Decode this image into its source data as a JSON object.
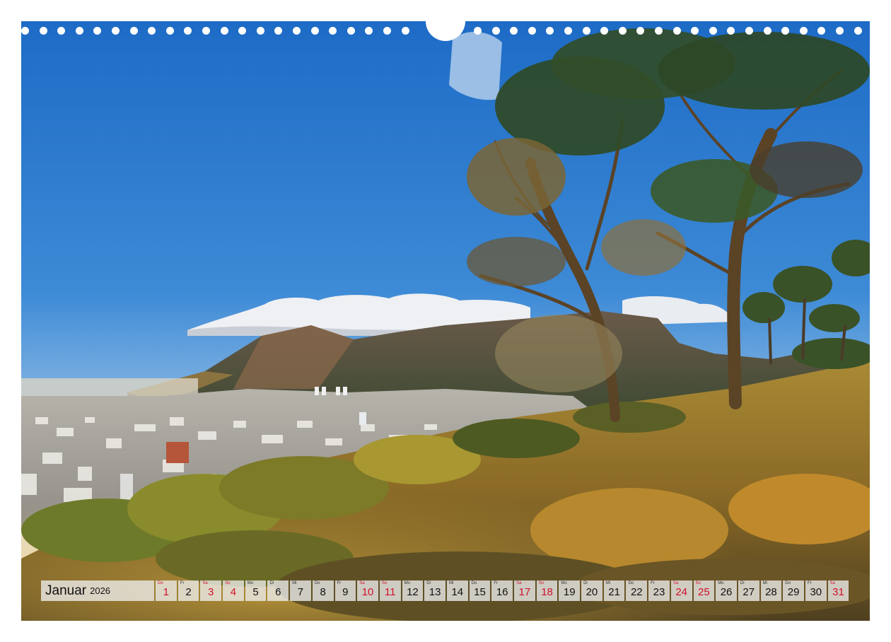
{
  "calendar": {
    "month": "Januar",
    "year": "2026",
    "days": [
      {
        "wd": "Do",
        "num": "1",
        "weekend": true
      },
      {
        "wd": "Fr",
        "num": "2",
        "weekend": false
      },
      {
        "wd": "Sa",
        "num": "3",
        "weekend": true
      },
      {
        "wd": "So",
        "num": "4",
        "weekend": true
      },
      {
        "wd": "Mo",
        "num": "5",
        "weekend": false
      },
      {
        "wd": "Di",
        "num": "6",
        "weekend": false
      },
      {
        "wd": "Mi",
        "num": "7",
        "weekend": false
      },
      {
        "wd": "Do",
        "num": "8",
        "weekend": false
      },
      {
        "wd": "Fr",
        "num": "9",
        "weekend": false
      },
      {
        "wd": "Sa",
        "num": "10",
        "weekend": true
      },
      {
        "wd": "So",
        "num": "11",
        "weekend": true
      },
      {
        "wd": "Mo",
        "num": "12",
        "weekend": false
      },
      {
        "wd": "Di",
        "num": "13",
        "weekend": false
      },
      {
        "wd": "Mi",
        "num": "14",
        "weekend": false
      },
      {
        "wd": "Do",
        "num": "15",
        "weekend": false
      },
      {
        "wd": "Fr",
        "num": "16",
        "weekend": false
      },
      {
        "wd": "Sa",
        "num": "17",
        "weekend": true
      },
      {
        "wd": "So",
        "num": "18",
        "weekend": true
      },
      {
        "wd": "Mo",
        "num": "19",
        "weekend": false
      },
      {
        "wd": "Di",
        "num": "20",
        "weekend": false
      },
      {
        "wd": "Mi",
        "num": "21",
        "weekend": false
      },
      {
        "wd": "Do",
        "num": "22",
        "weekend": false
      },
      {
        "wd": "Fr",
        "num": "23",
        "weekend": false
      },
      {
        "wd": "Sa",
        "num": "24",
        "weekend": true
      },
      {
        "wd": "So",
        "num": "25",
        "weekend": true
      },
      {
        "wd": "Mo",
        "num": "26",
        "weekend": false
      },
      {
        "wd": "Di",
        "num": "27",
        "weekend": false
      },
      {
        "wd": "Mi",
        "num": "28",
        "weekend": false
      },
      {
        "wd": "Do",
        "num": "29",
        "weekend": false
      },
      {
        "wd": "Fr",
        "num": "30",
        "weekend": false
      },
      {
        "wd": "Sa",
        "num": "31",
        "weekend": true
      }
    ]
  },
  "colors": {
    "weekend": "#d0112b",
    "sky_top": "#1f6ec8",
    "grass": "#b08a2e"
  }
}
